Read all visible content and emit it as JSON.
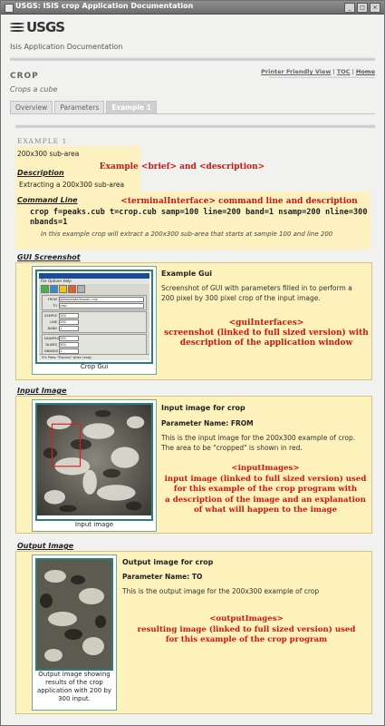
{
  "window": {
    "title": "USGS: ISIS crop Application Documentation"
  },
  "header": {
    "logo_text": "USGS",
    "subtitle": "Isis Application Documentation",
    "links": {
      "printer": "Printer Friendly View",
      "toc": "TOC",
      "home": "Home",
      "separator": "|"
    }
  },
  "program": {
    "name": "CROP",
    "brief": "Crops a cube"
  },
  "tabs": [
    {
      "label": "Overview",
      "active": false
    },
    {
      "label": "Parameters",
      "active": false
    },
    {
      "label": "Example 1",
      "active": true
    }
  ],
  "example": {
    "title": "EXAMPLE 1",
    "brief": "200x300 sub-area",
    "description_heading": "Description",
    "description": "Extracting a 200x300 sub-area",
    "command_line_heading": "Command Line",
    "command": "crop f=peaks.cub t=crop.cub samp=100 line=200 band=1 nsamp=200 nline=300 nbands=1",
    "command_note": "In this example crop will extract a 200x300 sub-area that starts at sample 100 and line 200"
  },
  "gui_section": {
    "heading": "GUI Screenshot",
    "thumb_caption": "Crop Gui",
    "title": "Example Gui",
    "text": "Screenshot of GUI with parameters filled in to perform a 200 pixel by 300 pixel crop of the input image.",
    "mock": {
      "menu": "File  Options  Help",
      "group_files": "Files",
      "from_label": "FROM",
      "from_value": "/data/peaks/mosaic.cub",
      "to_label": "TO",
      "to_value": "crop",
      "group_start": "Starting Coordinates",
      "sample_label": "SAMPLE",
      "sample_value": "100",
      "line_label": "LINE",
      "line_value": "200",
      "band_label": "BAND",
      "band_value": "1",
      "group_output": "Output Dimensions",
      "nsamples_label": "NSAMPLES",
      "nsamples_value": "200",
      "nlines_label": "NLINES",
      "nlines_value": "300",
      "nbands_label": "NBANDS",
      "nbands_value": "1",
      "status": "0%    Press \"Process\" when ready"
    }
  },
  "input_section": {
    "heading": "Input Image",
    "thumb_caption": "Input image",
    "title": "Input image for crop",
    "param": "Parameter Name: FROM",
    "text": "This is the input image for the 200x300 example of crop. The area to be \"cropped\" is shown in red."
  },
  "output_section": {
    "heading": "Output Image",
    "thumb_caption": "Output image showing results of the crop application with 200 by 300 input.",
    "title": "Output image for crop",
    "param": "Parameter Name: TO",
    "text": "This is the output image for the 200x300 example of crop"
  },
  "annotations": {
    "brief": "Example <brief> and <description>",
    "terminal": "<terminalInterface> command line and description",
    "gui_1": "<guiInterfaces>",
    "gui_2": "screenshot (linked to full sized version) with",
    "gui_3": "description of the application window",
    "input_1": "<inputImages>",
    "input_2": "input image (linked to full sized version) used",
    "input_3": "for this example of the crop program with",
    "input_4": "a description of the image and an explanation",
    "input_5": "of what will happen to the image",
    "output_1": "<outputImages>",
    "output_2": "resulting image (linked to full sized version) used",
    "output_3": "for this example of the crop program"
  },
  "colors": {
    "annotation": "#d2150e",
    "panel": "#fdf1bc",
    "thumb_border": "#2e7d7d"
  }
}
